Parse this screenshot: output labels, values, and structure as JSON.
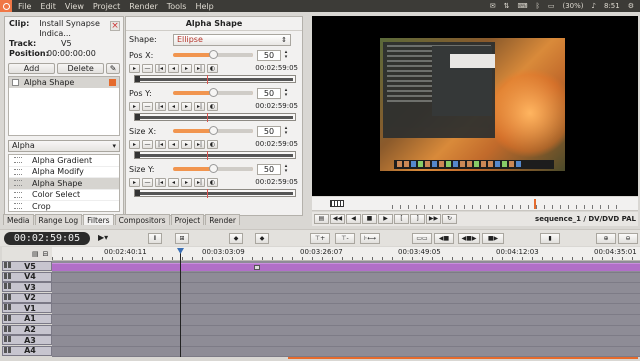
{
  "system": {
    "menus": [
      "File",
      "Edit",
      "View",
      "Project",
      "Render",
      "Tools",
      "Help"
    ],
    "battery": "(30%)",
    "time": "8:51"
  },
  "clip": {
    "clip_label": "Clip:",
    "clip_value": "Install Synapse Indica...",
    "track_label": "Track:",
    "track_value": "V5",
    "position_label": "Position:",
    "position_value": "00:00:00:00"
  },
  "buttons": {
    "add": "Add",
    "delete": "Delete"
  },
  "applied_filters": [
    "Alpha Shape"
  ],
  "category_select": "Alpha",
  "available_filters": [
    "Alpha Gradient",
    "Alpha Modify",
    "Alpha Shape",
    "Color Select",
    "Crop"
  ],
  "params": {
    "title": "Alpha Shape",
    "shape_label": "Shape:",
    "shape_value": "Ellipse",
    "rows": [
      {
        "label": "Pos X:",
        "value": "50",
        "time": "00:02:59:05",
        "fill": 0.5
      },
      {
        "label": "Pos Y:",
        "value": "50",
        "time": "00:02:59:05",
        "fill": 0.5
      },
      {
        "label": "Size X:",
        "value": "50",
        "time": "00:02:59:05",
        "fill": 0.5
      },
      {
        "label": "Size Y:",
        "value": "50",
        "time": "00:02:59:05",
        "fill": 0.5
      }
    ]
  },
  "tabs": [
    "Media",
    "Range Log",
    "Filters",
    "Compositors",
    "Project",
    "Render"
  ],
  "active_tab": "Filters",
  "monitor": {
    "sequence": "sequence_1 / DV/DVD PAL"
  },
  "timeline": {
    "timecode": "00:02:59:05",
    "ruler_labels": [
      "00:02:40:11",
      "00:03:03:09",
      "00:03:26:07",
      "00:03:49:05",
      "00:04:12:03",
      "00:04:35:01"
    ],
    "tracks": [
      "V5",
      "V4",
      "V3",
      "V2",
      "V1",
      "A1",
      "A2",
      "A3",
      "A4"
    ]
  },
  "colors": {
    "accent": "#e56b2d",
    "clip": "#b16fc7",
    "track_bg": "#8e8c96"
  }
}
